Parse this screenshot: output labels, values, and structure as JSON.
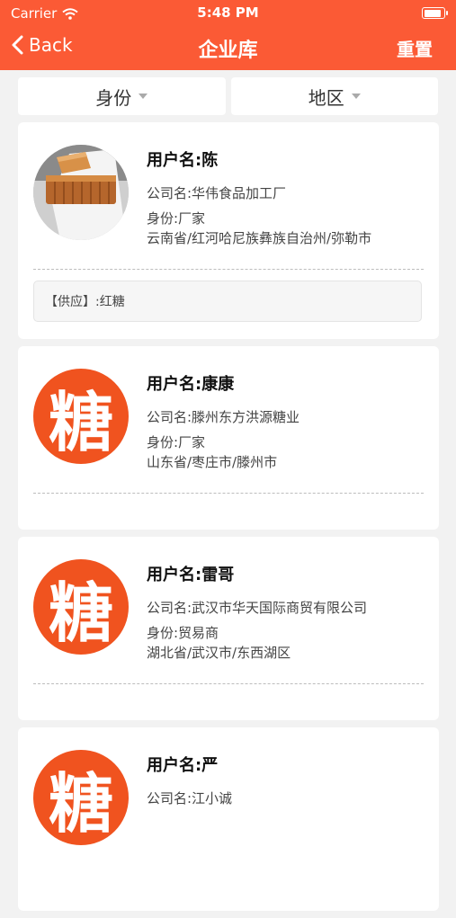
{
  "status_bar": {
    "carrier": "Carrier",
    "time": "5:48 PM"
  },
  "nav": {
    "back_label": "Back",
    "title": "企业库",
    "reset_label": "重置"
  },
  "filters": [
    {
      "label": "身份"
    },
    {
      "label": "地区"
    }
  ],
  "accent_color": "#fb5a35",
  "avatar_glyph": "糖",
  "cards": [
    {
      "username": "用户名:陈",
      "company": "公司名:华伟食品加工厂",
      "identity": "身份:厂家",
      "region": "云南省/红河哈尼族彝族自治州/弥勒市",
      "supply": "【供应】:红糖",
      "avatar": "photo"
    },
    {
      "username": "用户名:康康",
      "company": "公司名:滕州东方洪源糖业",
      "identity": "身份:厂家",
      "region": "山东省/枣庄市/滕州市",
      "avatar": "sugar"
    },
    {
      "username": "用户名:雷哥",
      "company": "公司名:武汉市华天国际商贸有限公司",
      "identity": "身份:贸易商",
      "region": "湖北省/武汉市/东西湖区",
      "avatar": "sugar"
    },
    {
      "username": "用户名:严",
      "company": "公司名:江小诚",
      "avatar": "sugar"
    }
  ]
}
